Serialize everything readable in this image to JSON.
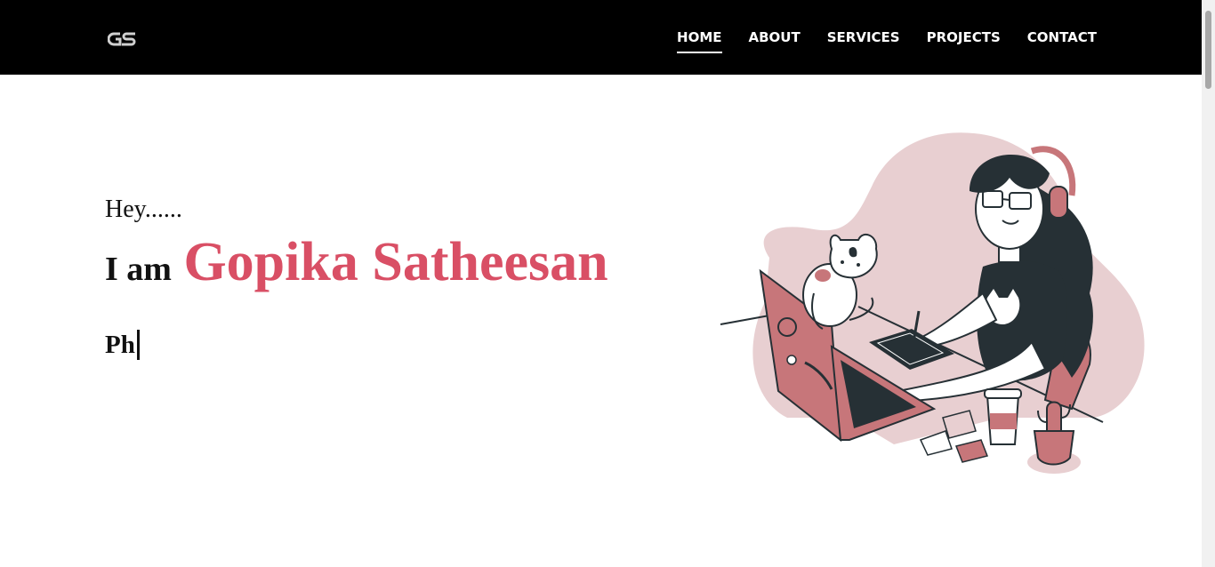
{
  "nav": {
    "logo_text": "GS",
    "items": [
      {
        "label": "HOME",
        "active": true
      },
      {
        "label": "ABOUT",
        "active": false
      },
      {
        "label": "SERVICES",
        "active": false
      },
      {
        "label": "PROJECTS",
        "active": false
      },
      {
        "label": "CONTACT",
        "active": false
      }
    ]
  },
  "hero": {
    "greeting": "Hey......",
    "intro_prefix": "I am",
    "name": "Gopika Satheesan",
    "typed_text": "Ph"
  },
  "colors": {
    "accent": "#d94f65",
    "navbar_bg": "#000000",
    "illustration_pink": "#e8cfd1",
    "illustration_rose": "#c7767a",
    "illustration_dark": "#263035"
  },
  "illustration": {
    "icon": "woman-working-on-laptop-with-cat-illustration"
  }
}
